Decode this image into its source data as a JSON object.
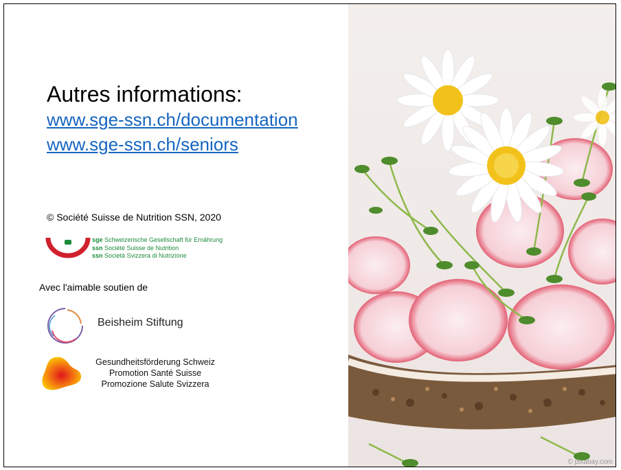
{
  "slide": {
    "heading": "Autres informations:",
    "links": [
      "www.sge-ssn.ch/documentation",
      "www.sge-ssn.ch/seniors"
    ],
    "copyright": "© Société Suisse de Nutrition SSN, 2020",
    "sge": {
      "line1_abbr": "sge",
      "line1": " Schweizerische Gesellschaft für Ernährung",
      "line2_abbr": "ssn",
      "line2": " Société Suisse de Nutrition",
      "line3_abbr": "ssn",
      "line3": " Società Svizzera di Nutrizione"
    },
    "support_label": "Avec l'aimable soutien de",
    "beisheim": "Beisheim Stiftung",
    "gesundheit": [
      "Gesundheitsförderung Schweiz",
      "Promotion Santé Suisse",
      "Promozione Salute Svizzera"
    ],
    "photo_watermark": "© pixabay.com"
  },
  "colors": {
    "link": "#1565c0",
    "sge_green": "#1d8a3b",
    "sge_red": "#d0202e"
  }
}
